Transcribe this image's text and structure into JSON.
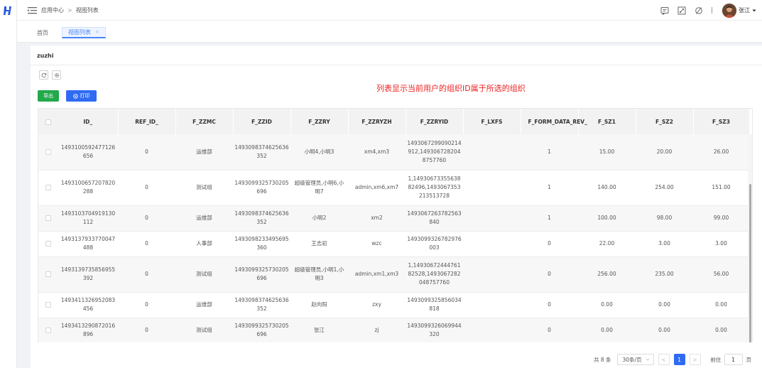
{
  "breadcrumb": {
    "root": "应用中心",
    "separator": ">",
    "current": "视图列表"
  },
  "user": {
    "name": "张江"
  },
  "tabs": [
    {
      "label": "首页"
    },
    {
      "label": "视图列表",
      "close": "×"
    }
  ],
  "card": {
    "title": "zuzhi",
    "export_label": "导出",
    "print_label": "打印",
    "note": "列表显示当前用户的组织ID属于所选的组织"
  },
  "table": {
    "columns": [
      "ID_",
      "REF_ID_",
      "F_ZZMC",
      "F_ZZID",
      "F_ZZRY",
      "F_ZZRYZH",
      "F_ZZRYID",
      "F_LXFS",
      "F_FORM_DATA_REV_",
      "F_SZ1",
      "F_SZ2",
      "F_SZ3"
    ],
    "rows": [
      [
        "1493100592477126656",
        "0",
        "运维部",
        "1493098374625636352",
        "小明4,小明3",
        "xm4,xm3",
        "1493067299090214912,1493067282048757760",
        "",
        "1",
        "15.00",
        "20.00",
        "26.00"
      ],
      [
        "1493100657207820288",
        "0",
        "测试组",
        "1493099325730205696",
        "超级管理员,小明6,小明7",
        "admin,xm6,xm7",
        "1,1493067335563882496,1493067353213513728",
        "",
        "1",
        "140.00",
        "254.00",
        "151.00"
      ],
      [
        "1493103704919130112",
        "0",
        "运维部",
        "1493098374625636352",
        "小明2",
        "xm2",
        "1493067263782563840",
        "",
        "1",
        "100.00",
        "98.00",
        "99.00"
      ],
      [
        "1493137933770047488",
        "0",
        "人事部",
        "1493098233495695360",
        "王志初",
        "wzc",
        "1493099326782976003",
        "",
        "0",
        "22.00",
        "3.00",
        "3.00"
      ],
      [
        "1493139735856955392",
        "0",
        "测试组",
        "1493099325730205696",
        "超级管理员,小明1,小明3",
        "admin,xm1,xm3",
        "1,1493067244476182528,1493067282048757760",
        "",
        "0",
        "256.00",
        "235.00",
        "56.00"
      ],
      [
        "1493411326952083456",
        "0",
        "运维部",
        "1493098374625636352",
        "赵向阳",
        "zxy",
        "1493099325856034818",
        "",
        "0",
        "0.00",
        "0.00",
        "0.00"
      ],
      [
        "1493413290872016896",
        "0",
        "测试组",
        "1493099325730205696",
        "张江",
        "zj",
        "1493099326069944320",
        "",
        "0",
        "0.00",
        "0.00",
        "0.00"
      ]
    ]
  },
  "pager": {
    "total": "共 8 条",
    "page_size": "30条/页",
    "prev": "<",
    "current": "1",
    "next": ">",
    "goto_prefix": "前往",
    "goto_value": "1",
    "goto_suffix": "页"
  },
  "colors": {
    "primary": "#2f6bf2",
    "success": "#22a94b",
    "note": "#ee2222"
  }
}
